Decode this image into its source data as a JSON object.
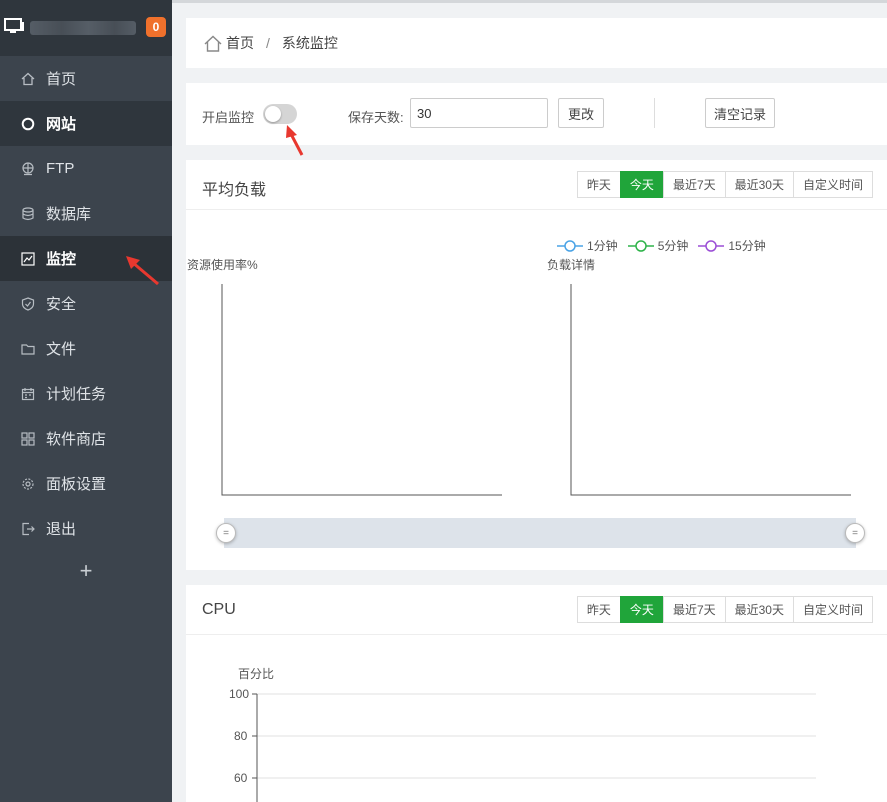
{
  "sidebar": {
    "badge": "0",
    "items": [
      {
        "label": "首页",
        "icon": "home-icon"
      },
      {
        "label": "网站",
        "icon": "globe-icon"
      },
      {
        "label": "FTP",
        "icon": "ftp-icon"
      },
      {
        "label": "数据库",
        "icon": "database-icon"
      },
      {
        "label": "监控",
        "icon": "monitor-chart-icon"
      },
      {
        "label": "安全",
        "icon": "shield-icon"
      },
      {
        "label": "文件",
        "icon": "folder-icon"
      },
      {
        "label": "计划任务",
        "icon": "calendar-icon"
      },
      {
        "label": "软件商店",
        "icon": "grid-icon"
      },
      {
        "label": "面板设置",
        "icon": "gear-icon"
      },
      {
        "label": "退出",
        "icon": "logout-icon"
      }
    ],
    "add_label": "+"
  },
  "breadcrumb": {
    "home": "首页",
    "separator": "/",
    "current": "系统监控"
  },
  "controls": {
    "enable_label": "开启监控",
    "enabled": false,
    "days_label": "保存天数:",
    "days_value": "30",
    "change_button": "更改",
    "clear_button": "清空记录"
  },
  "tabs": [
    "昨天",
    "今天",
    "最近7天",
    "最近30天",
    "自定义时间"
  ],
  "active_tab": "今天",
  "load_panel": {
    "title": "平均负载",
    "left_axis_title": "资源使用率%",
    "right_axis_title": "负载详情",
    "legend": [
      {
        "name": "1分钟",
        "color": "#4aa3e6"
      },
      {
        "name": "5分钟",
        "color": "#2fb34a"
      },
      {
        "name": "15分钟",
        "color": "#9b4fd6"
      }
    ]
  },
  "cpu_panel": {
    "title": "CPU",
    "axis_title": "百分比",
    "y_ticks": [
      "100",
      "80",
      "60"
    ]
  },
  "colors": {
    "accent": "#20a53a",
    "sidebar": "#3c444d",
    "arrow": "#e8382f"
  }
}
